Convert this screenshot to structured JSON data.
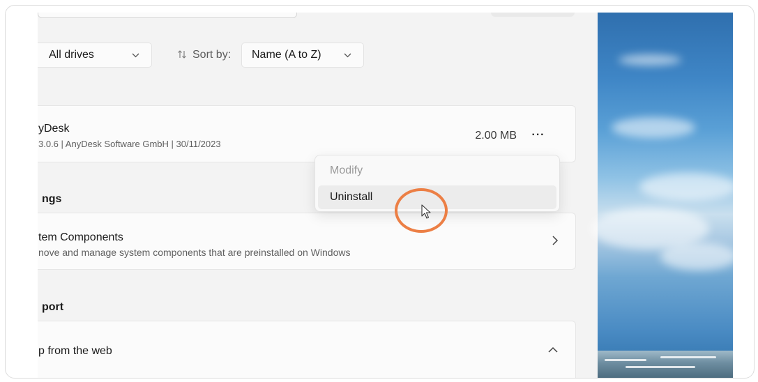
{
  "filters": {
    "drives_value": "All drives",
    "sort_label": "Sort by:",
    "sort_value": "Name (A to Z)"
  },
  "app": {
    "name": "yDesk",
    "meta": "3.0.6  |  AnyDesk Software GmbH  |  30/11/2023",
    "size": "2.00 MB",
    "more_glyph": "···"
  },
  "context_menu": {
    "modify": "Modify",
    "uninstall": "Uninstall"
  },
  "related_settings": {
    "title": "ngs",
    "system_components": {
      "title": "tem Components",
      "desc": "nove and manage system components that are preinstalled on Windows"
    }
  },
  "support": {
    "title": "port",
    "help_web": "p from the web"
  },
  "icons": {
    "sort": "sort-arrows-icon",
    "chevron_down": "chevron-down-icon",
    "chevron_right": "chevron-right-icon",
    "chevron_up": "chevron-up-icon",
    "more": "more-dots-icon",
    "cursor": "mouse-cursor-icon"
  },
  "colors": {
    "highlight_ring": "#ec7f45",
    "background": "#f3f3f3",
    "card": "#fbfbfb"
  }
}
